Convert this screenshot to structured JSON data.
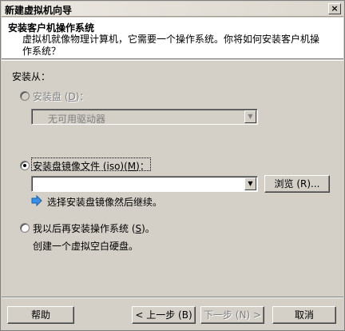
{
  "window": {
    "title": "新建虚拟机向导",
    "close_glyph": "×"
  },
  "header": {
    "title": "安装客户机操作系统",
    "subtitle": "虚拟机就像物理计算机，它需要一个操作系统。你将如何安装客户机操作系统？"
  },
  "install_from_label": "安装从：",
  "options": {
    "disc": {
      "label_prefix": "安装盘 (",
      "label_key": "D",
      "label_suffix": ")：",
      "checked": false,
      "enabled": false,
      "combo_value": "无可用驱动器"
    },
    "iso": {
      "label_prefix": "安装盘镜像文件 (iso)(",
      "label_key": "M",
      "label_suffix": ")：",
      "checked": true,
      "enabled": true,
      "path_value": "",
      "browse_label": "浏览 (R)...",
      "hint": "选择安装盘镜像然后继续。"
    },
    "later": {
      "label_prefix": "我以后再安装操作系统 (",
      "label_key": "S",
      "label_suffix": ")。",
      "checked": false,
      "enabled": true,
      "description": "创建一个虚拟空白硬盘。"
    }
  },
  "footer": {
    "help": "帮助",
    "back": "< 上一步 (B)",
    "next": "下一步 (N) >",
    "cancel": "取消"
  },
  "colors": {
    "dialog_bg": "#d4d0c8",
    "header_bg": "#ffffff",
    "hint_arrow": "#3a8ee6"
  }
}
